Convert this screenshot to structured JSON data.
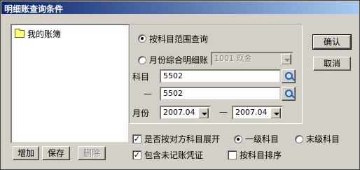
{
  "window": {
    "title": "明细账查询条件"
  },
  "tree": {
    "items": [
      {
        "label": "我的账簿"
      }
    ]
  },
  "left_buttons": {
    "add": "增加",
    "save": "保存",
    "delete": "删除"
  },
  "query_mode": {
    "by_subject_range": "按科目范围查询",
    "by_month_summary": "月份综合明细账",
    "month_summary_account": "1001 现金"
  },
  "subject": {
    "label": "科目",
    "separator": "—",
    "from": "5502",
    "to": "5502"
  },
  "month": {
    "label": "月份",
    "from": "2007.04",
    "separator": "—",
    "to": "2007.04"
  },
  "options": {
    "expand_by_counterpart": "是否按对方科目展开",
    "level_first": "一级科目",
    "level_last": "末级科目",
    "include_unposted": "包含未记账凭证",
    "sort_by_subject": "按科目排序",
    "expand_checked": true,
    "include_unposted_checked": true,
    "sort_checked": false,
    "level_selected": "一级科目"
  },
  "dialog_buttons": {
    "ok": "确认",
    "cancel": "取消"
  },
  "colors": {
    "titlebar_start": "#0a246a",
    "titlebar_end": "#a6caf0",
    "face": "#d4d0c8"
  }
}
